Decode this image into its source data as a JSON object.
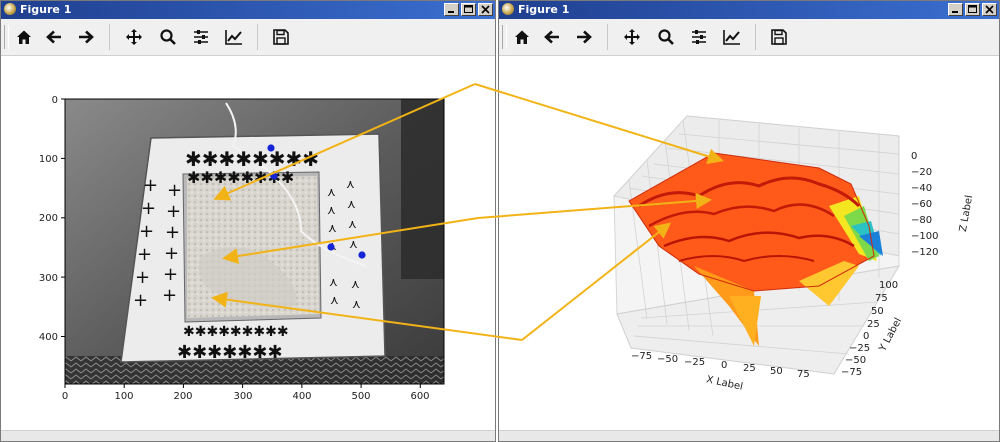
{
  "windows": [
    {
      "title": "Figure 1"
    },
    {
      "title": "Figure 1"
    }
  ],
  "toolbar": {
    "icons": [
      "home-icon",
      "back-arrow-icon",
      "forward-arrow-icon",
      "pan-move-icon",
      "zoom-magnifier-icon",
      "configure-subplots-icon",
      "edit-axis-curves-icon",
      "save-floppy-icon"
    ]
  },
  "left_plot": {
    "x_ticks": [
      "0",
      "100",
      "200",
      "300",
      "400",
      "500",
      "600"
    ],
    "y_ticks": [
      "0",
      "100",
      "200",
      "300",
      "400"
    ]
  },
  "right_plot": {
    "x_label": "X Label",
    "y_label": "Y Label",
    "z_label": "Z Label",
    "x_ticks": [
      "−75",
      "−50",
      "−25",
      "0",
      "25",
      "50",
      "75"
    ],
    "y_ticks": [
      "100",
      "75",
      "50",
      "25",
      "0",
      "−25",
      "−50",
      "−75"
    ],
    "z_ticks": [
      "0",
      "−20",
      "−40",
      "−60",
      "−80",
      "−100",
      "−120"
    ],
    "colormap": "jet (red high, blue low)"
  },
  "colors": {
    "title_gradient_start": "#1f3f8f",
    "title_gradient_end": "#3b6fd1",
    "arrow": "#f2b316",
    "marker": "#1524d6",
    "surface_red": "#e83a12"
  }
}
